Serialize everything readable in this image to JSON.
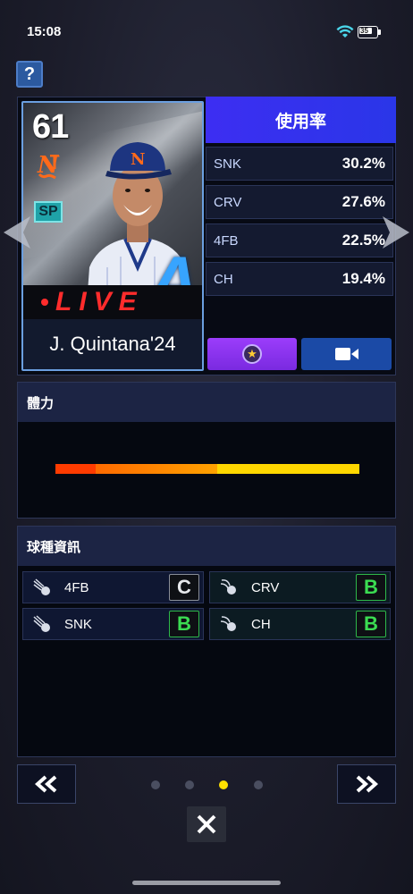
{
  "status_bar": {
    "time": "15:08",
    "battery_level": "35"
  },
  "help": {
    "label": "?"
  },
  "player_card": {
    "rating": "61",
    "position_badge": "SP",
    "grade": "A",
    "live_label": "LIVE",
    "name": "J. Quintana'24"
  },
  "usage": {
    "title": "使用率",
    "rows": [
      {
        "pitch": "SNK",
        "pct": "30.2%"
      },
      {
        "pitch": "CRV",
        "pct": "27.6%"
      },
      {
        "pitch": "4FB",
        "pct": "22.5%"
      },
      {
        "pitch": "CH",
        "pct": "19.4%"
      }
    ]
  },
  "stamina": {
    "title": "體力",
    "segments": [
      {
        "color": "#ff3b00",
        "fraction": 0.13
      },
      {
        "color": "#ff8a00",
        "fraction": 0.4
      },
      {
        "color": "#ffd700",
        "fraction": 0.47
      }
    ]
  },
  "pitch_info": {
    "title": "球種資訊",
    "items": [
      {
        "name": "4FB",
        "grade": "C"
      },
      {
        "name": "CRV",
        "grade": "B"
      },
      {
        "name": "SNK",
        "grade": "B"
      },
      {
        "name": "CH",
        "grade": "B"
      }
    ]
  },
  "pagination": {
    "total": 4,
    "current": 3
  },
  "colors": {
    "accent": "#3d2ef2",
    "grade_b": "#3bdc52",
    "live_red": "#ff2c2c",
    "active_dot": "#ffe000"
  }
}
